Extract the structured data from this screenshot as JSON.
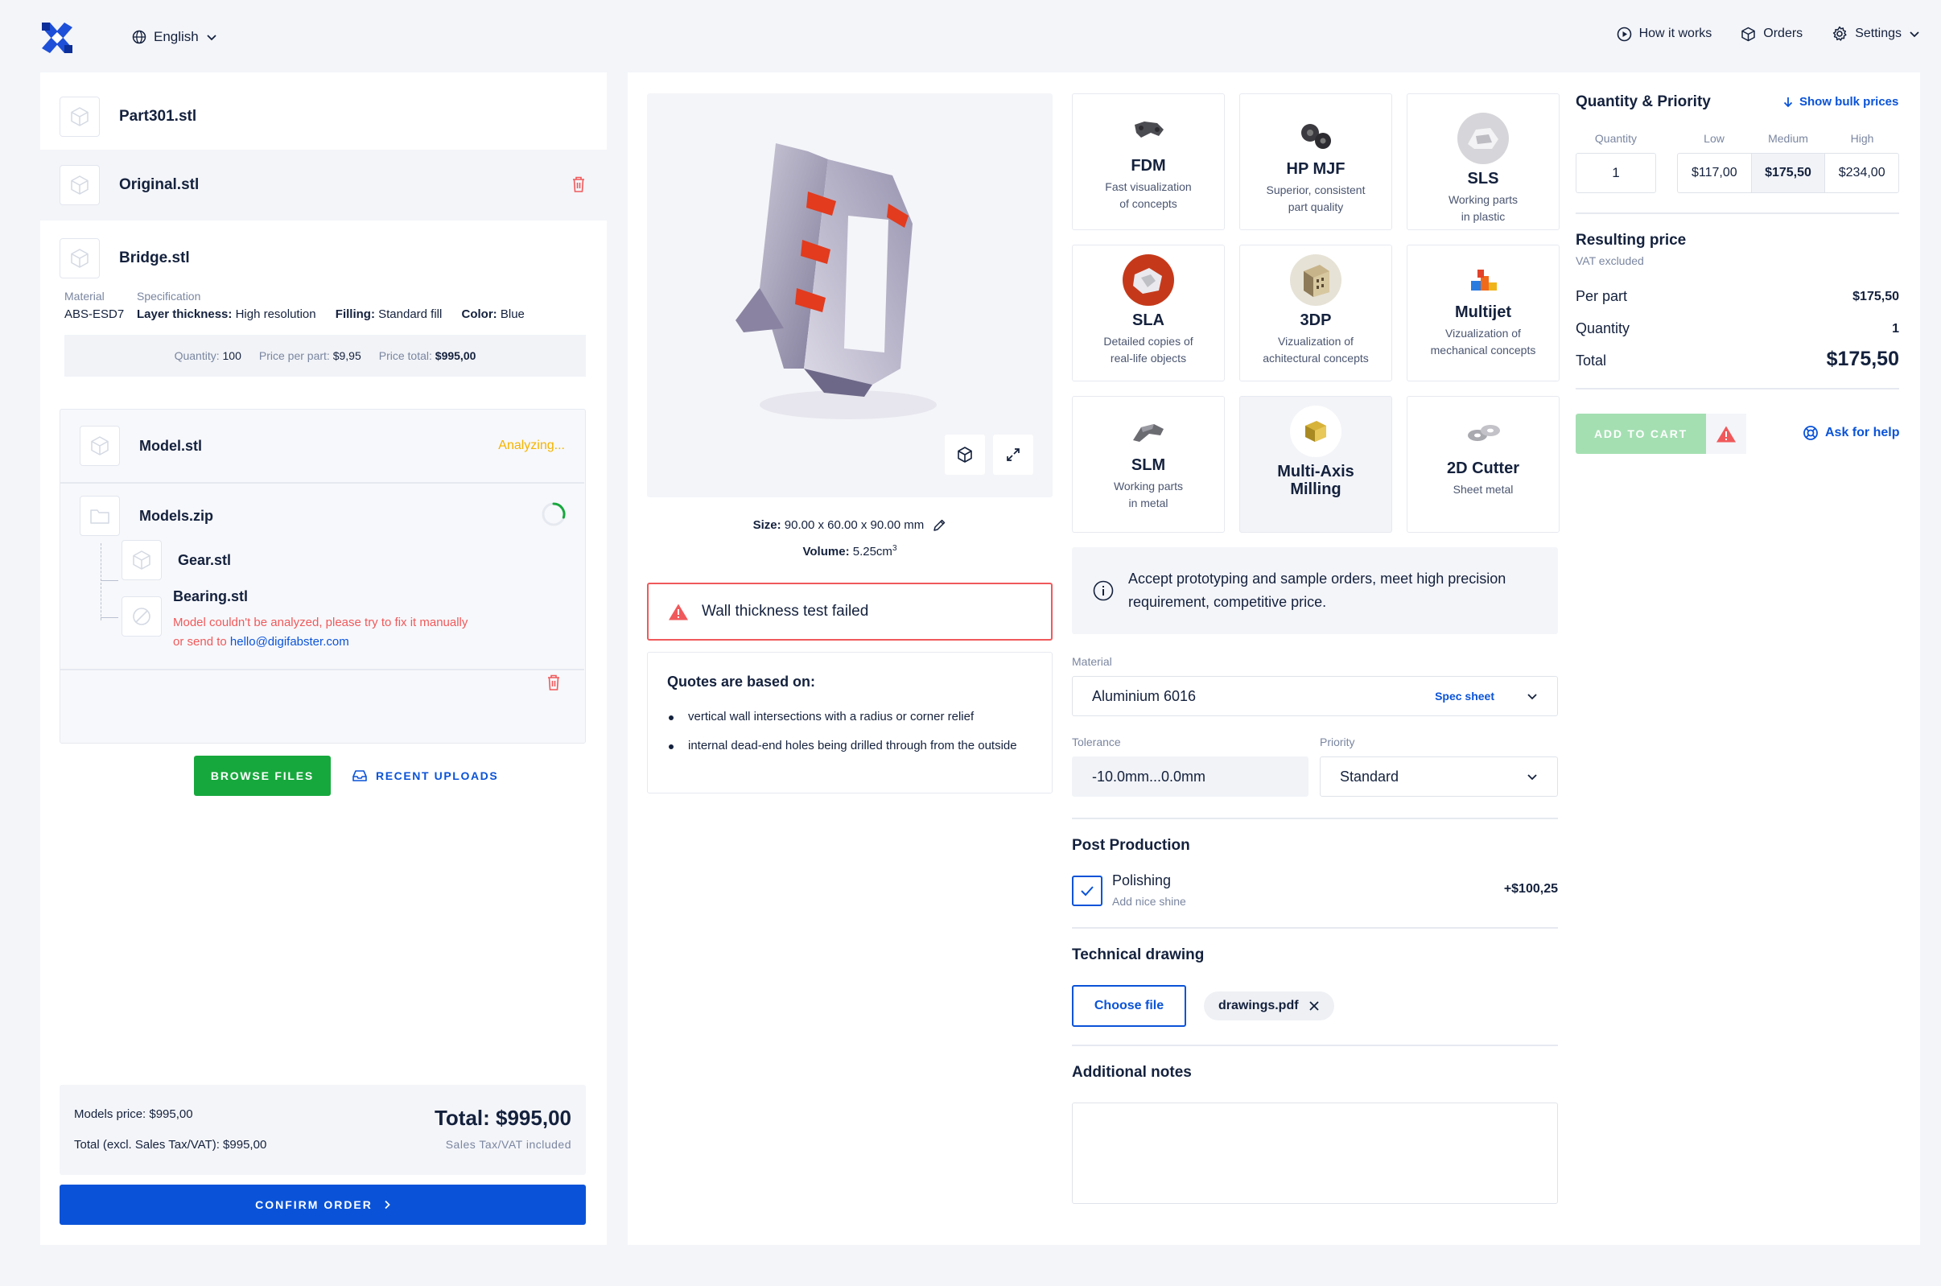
{
  "topbar": {
    "language": "English",
    "nav": [
      "How it works",
      "Orders",
      "Settings"
    ]
  },
  "files": {
    "part301": "Part301.stl",
    "original": "Original.stl",
    "bridge": {
      "name": "Bridge.stl",
      "material_label": "Material",
      "material_value": "ABS-ESD7",
      "spec_label": "Specification",
      "layer_label": "Layer thickness:",
      "layer_value": "High resolution",
      "filling_label": "Filling:",
      "filling_value": "Standard fill",
      "color_label": "Color:",
      "color_value": "Blue",
      "qty_label": "Quantity:",
      "qty_value": "100",
      "ppp_label": "Price per part:",
      "ppp_value": "$9,95",
      "pt_label": "Price total:",
      "pt_value": "$995,00"
    },
    "model": {
      "name": "Model.stl",
      "status": "Analyzing..."
    },
    "zip": {
      "name": "Models.zip",
      "progress": 0.3
    },
    "gear": "Gear.stl",
    "bearing": {
      "name": "Bearing.stl",
      "error_line1": "Model couldn't be analyzed, please try to fix it manually",
      "error_prefix": "or send to",
      "email": "hello@digifabster.com"
    },
    "browse_label": "BROWSE FILES",
    "recent_label": "RECENT UPLOADS"
  },
  "totals": {
    "models_price": "Models price: $995,00",
    "total_excl": "Total (excl. Sales Tax/VAT): $995,00",
    "total": "Total: $995,00",
    "tax_note": "Sales Tax/VAT included",
    "confirm": "CONFIRM ORDER"
  },
  "viewer": {
    "size_label": "Size:",
    "size_value": "90.00 x 60.00 x 90.00 mm",
    "volume_label": "Volume:",
    "volume_value": "5.25cm",
    "volume_sup": "3"
  },
  "warning": "Wall thickness test failed",
  "quotes": {
    "title": "Quotes are based on:",
    "items": [
      "vertical wall intersections with a radius or corner relief",
      "internal dead-end holes being drilled through from the outside"
    ]
  },
  "technologies": [
    {
      "title": "FDM",
      "desc1": "Fast visualization",
      "desc2": "of concepts"
    },
    {
      "title": "HP MJF",
      "desc1": "Superior, consistent",
      "desc2": "part quality"
    },
    {
      "title": "SLS",
      "desc1": "Working parts",
      "desc2": "in plastic"
    },
    {
      "title": "SLA",
      "desc1": "Detailed copies of",
      "desc2": "real-life objects"
    },
    {
      "title": "3DP",
      "desc1": "Vizualization of",
      "desc2": "achitectural concepts"
    },
    {
      "title": "Multijet",
      "desc1": "Vizualization of",
      "desc2": "mechanical concepts"
    },
    {
      "title": "SLM",
      "desc1": "Working parts",
      "desc2": "in metal"
    },
    {
      "title1": "Multi-Axis",
      "title2": "Milling"
    },
    {
      "title": "2D Cutter",
      "desc1": "Sheet metal"
    }
  ],
  "info": "Accept prototyping and sample orders, meet high precision requirement, competitive price.",
  "form": {
    "material_label": "Material",
    "material_value": "Aluminium 6016",
    "spec_sheet": "Spec sheet",
    "tolerance_label": "Tolerance",
    "tolerance_value": "-10.0mm...0.0mm",
    "priority_label": "Priority",
    "priority_value": "Standard",
    "post_title": "Post Production",
    "polish_title": "Polishing",
    "polish_desc": "Add nice shine",
    "polish_price": "+$100,25",
    "drawing_title": "Technical drawing",
    "choose_file": "Choose file",
    "file_name": "drawings.pdf",
    "notes_title": "Additional notes"
  },
  "pricing": {
    "title": "Quantity & Priority",
    "bulk_link": "Show bulk prices",
    "qty_label": "Quantity",
    "qty_value": "1",
    "tiers": [
      {
        "label": "Low",
        "price": "$117,00"
      },
      {
        "label": "Medium",
        "price": "$175,50"
      },
      {
        "label": "High",
        "price": "$234,00"
      }
    ],
    "result_title": "Resulting price",
    "vat_note": "VAT excluded",
    "per_part_label": "Per part",
    "per_part_value": "$175,50",
    "quantity_label": "Quantity",
    "quantity_value": "1",
    "total_label": "Total",
    "total_value": "$175,50",
    "add_to_cart": "ADD TO CART",
    "help": "Ask for help"
  },
  "colors": {
    "primary": "#0a53d8",
    "success": "#17a83d",
    "danger": "#f0595b",
    "warning": "#f5b400",
    "text": "#14213d"
  }
}
